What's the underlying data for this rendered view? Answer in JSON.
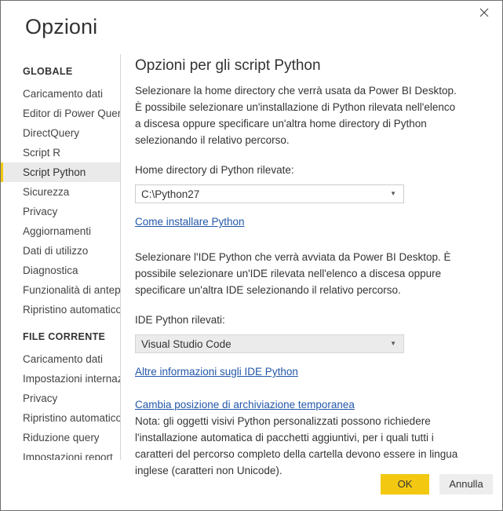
{
  "window": {
    "title": "Opzioni",
    "close_icon": "close-icon"
  },
  "sidebar": {
    "sections": [
      {
        "heading": "GLOBALE",
        "items": [
          {
            "label": "Caricamento dati",
            "selected": false
          },
          {
            "label": "Editor di Power Query",
            "selected": false
          },
          {
            "label": "DirectQuery",
            "selected": false
          },
          {
            "label": "Script R",
            "selected": false
          },
          {
            "label": "Script Python",
            "selected": true
          },
          {
            "label": "Sicurezza",
            "selected": false
          },
          {
            "label": "Privacy",
            "selected": false
          },
          {
            "label": "Aggiornamenti",
            "selected": false
          },
          {
            "label": "Dati di utilizzo",
            "selected": false
          },
          {
            "label": "Diagnostica",
            "selected": false
          },
          {
            "label": "Funzionalità di anteprima",
            "selected": false
          },
          {
            "label": "Ripristino automatico",
            "selected": false
          }
        ]
      },
      {
        "heading": "FILE CORRENTE",
        "items": [
          {
            "label": "Caricamento dati",
            "selected": false
          },
          {
            "label": "Impostazioni internazionali",
            "selected": false
          },
          {
            "label": "Privacy",
            "selected": false
          },
          {
            "label": "Ripristino automatico",
            "selected": false
          },
          {
            "label": "Riduzione query",
            "selected": false
          },
          {
            "label": "Impostazioni report",
            "selected": false
          }
        ]
      }
    ]
  },
  "content": {
    "title": "Opzioni per gli script Python",
    "intro_paragraph": "Selezionare la home directory che verrà usata da Power BI Desktop. È possibile selezionare un'installazione di Python rilevata nell'elenco a discesa oppure specificare un'altra home directory di Python selezionando il relativo percorso.",
    "home_dir_label": "Home directory di Python rilevate:",
    "home_dir_value": "C:\\Python27",
    "install_python_link": "Come installare Python",
    "ide_paragraph": "Selezionare l'IDE Python che verrà avviata da Power BI Desktop. È possibile selezionare un'IDE rilevata nell'elenco a discesa oppure specificare un'altra IDE selezionando il relativo percorso.",
    "ide_label": "IDE Python rilevati:",
    "ide_value": "Visual Studio Code",
    "ide_info_link": "Altre informazioni sugli IDE Python",
    "temp_storage_link": "Cambia posizione di archiviazione temporanea",
    "note_paragraph": "Nota: gli oggetti visivi Python personalizzati possono richiedere l'installazione automatica di pacchetti aggiuntivi, per i quali tutti i caratteri del percorso completo della cartella devono essere in lingua inglese (caratteri non Unicode)."
  },
  "footer": {
    "ok_label": "OK",
    "cancel_label": "Annulla"
  },
  "colors": {
    "accent": "#f2c811",
    "link": "#2357a8",
    "selected_bg": "#eaeaea",
    "text": "#333333",
    "border": "#6e6e6e"
  }
}
